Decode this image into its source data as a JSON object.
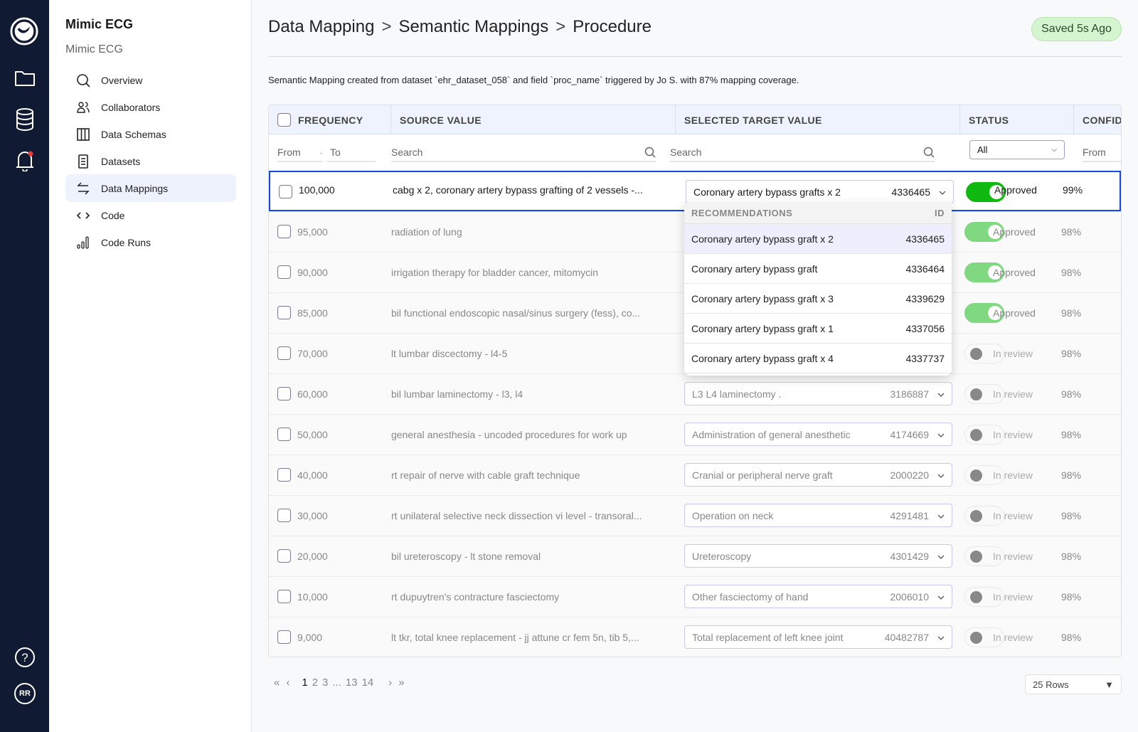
{
  "app": {
    "project_title": "Mimic ECG",
    "project_subtitle": "Mimic ECG"
  },
  "rail": {
    "icons": [
      "logo-icon",
      "folder-icon",
      "database-icon",
      "bell-icon",
      "help-icon"
    ],
    "avatar": "RR",
    "notification_color": "#e53935"
  },
  "sidebar": {
    "items": [
      {
        "label": "Overview",
        "icon": "search-icon"
      },
      {
        "label": "Collaborators",
        "icon": "users-icon"
      },
      {
        "label": "Data Schemas",
        "icon": "columns-icon"
      },
      {
        "label": "Datasets",
        "icon": "document-icon"
      },
      {
        "label": "Data Mappings",
        "icon": "arrows-swap-icon",
        "active": true
      },
      {
        "label": "Code",
        "icon": "code-icon"
      },
      {
        "label": "Code Runs",
        "icon": "bar-chart-icon"
      }
    ]
  },
  "breadcrumb": [
    "Data Mapping",
    "Semantic Mappings",
    "Procedure"
  ],
  "breadcrumb_separator": ">",
  "saved_badge": "Saved 5s Ago",
  "description": "Semantic Mapping created from dataset `ehr_dataset_058` and field `proc_name` triggered by Jo S. with 87% mapping coverage.",
  "table": {
    "headers": [
      "FREQUENCY",
      "SOURCE VALUE",
      "SELECTED TARGET VALUE",
      "STATUS",
      "CONFID"
    ],
    "filters": {
      "freq_from": "From",
      "freq_to": "To",
      "source_search": "Search",
      "target_search": "Search",
      "status": "All",
      "conf_from": "From"
    },
    "rows": [
      {
        "frequency": "100,000",
        "source": "cabg x 2, coronary artery bypass grafting of 2 vessels -...",
        "target": "Coronary artery bypass grafts x 2",
        "target_id": "4336465",
        "approved": true,
        "status": "Approved",
        "confidence": "99%",
        "selected": true
      },
      {
        "frequency": "95,000",
        "source": "radiation of lung",
        "approved": true,
        "status": "Approved",
        "confidence": "98%"
      },
      {
        "frequency": "90,000",
        "source": "irrigation therapy for bladder cancer, mitomycin",
        "approved": true,
        "status": "Approved",
        "confidence": "98%"
      },
      {
        "frequency": "85,000",
        "source": "bil functional endoscopic nasal/sinus surgery (fess), co...",
        "approved": true,
        "status": "Approved",
        "confidence": "98%"
      },
      {
        "frequency": "70,000",
        "source": "lt lumbar discectomy   - l4-5",
        "approved": false,
        "status": "In review",
        "confidence": "98%"
      },
      {
        "frequency": "60,000",
        "source": "bil lumbar laminectomy   - l3, l4",
        "target": "L3 L4 laminectomy            .",
        "target_id": "3186887",
        "approved": false,
        "status": "In review",
        "confidence": "98%"
      },
      {
        "frequency": "50,000",
        "source": "general anesthesia - uncoded procedures for work up",
        "target": "Administration of general anesthetic",
        "target_id": "4174669",
        "approved": false,
        "status": "In review",
        "confidence": "98%"
      },
      {
        "frequency": "40,000",
        "source": "rt repair of nerve with cable graft technique",
        "target": "Cranial or peripheral nerve graft",
        "target_id": "2000220",
        "approved": false,
        "status": "In review",
        "confidence": "98%"
      },
      {
        "frequency": "30,000",
        "source": "rt unilateral selective neck dissection vi level   - transoral...",
        "target": "Operation on neck",
        "target_id": "4291481",
        "approved": false,
        "status": "In review",
        "confidence": "98%"
      },
      {
        "frequency": "20,000",
        "source": "bil ureteroscopy   - lt stone removal",
        "target": "Ureteroscopy",
        "target_id": "4301429",
        "approved": false,
        "status": "In review",
        "confidence": "98%"
      },
      {
        "frequency": "10,000",
        "source": "rt dupuytren's contracture fasciectomy",
        "target": "Other fasciectomy of hand",
        "target_id": "2006010",
        "approved": false,
        "status": "In review",
        "confidence": "98%"
      },
      {
        "frequency": "9,000",
        "source": "lt tkr, total knee replacement   - jj attune cr fem 5n, tib 5,...",
        "target": "Total replacement of left knee joint",
        "target_id": "40482787",
        "approved": false,
        "status": "In review",
        "confidence": "98%"
      }
    ]
  },
  "recommendations": {
    "header": "RECOMMENDATIONS",
    "id_header": "ID",
    "items": [
      {
        "label": "Coronary artery bypass graft x 2",
        "id": "4336465",
        "highlighted": true
      },
      {
        "label": "Coronary artery bypass graft",
        "id": "4336464"
      },
      {
        "label": "Coronary artery bypass graft x 3",
        "id": "4339629"
      },
      {
        "label": "Coronary artery bypass graft x 1",
        "id": "4337056"
      },
      {
        "label": "Coronary artery bypass graft x 4",
        "id": "4337737"
      }
    ]
  },
  "pagination": {
    "first": "«",
    "prev": "‹",
    "pages": [
      "1",
      "2",
      "3",
      "...",
      "13",
      "14"
    ],
    "current": "1",
    "next": "›",
    "last": "»",
    "rows_per_page": "25 Rows"
  },
  "colors": {
    "rail": "#111a33",
    "accent": "#1447e6",
    "approved": "#10b90f",
    "active_nav": "#eef2fc"
  }
}
